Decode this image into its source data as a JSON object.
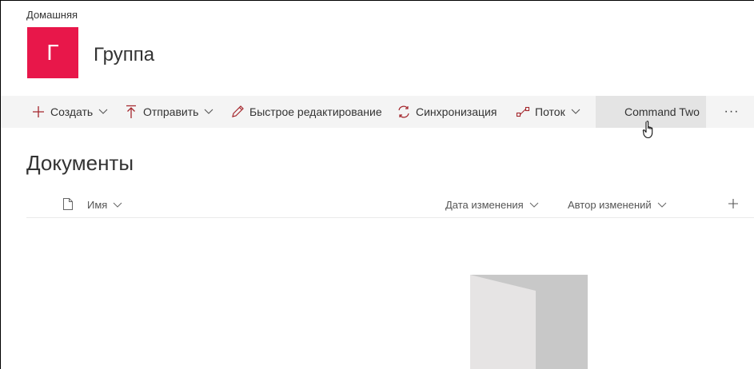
{
  "breadcrumb": "Домашняя",
  "site": {
    "logo_letter": "Г",
    "title": "Группа",
    "logo_color": "#e8174a"
  },
  "commandbar": {
    "items": [
      {
        "label": "Создать",
        "icon": "plus-icon",
        "has_dropdown": true
      },
      {
        "label": "Отправить",
        "icon": "upload-icon",
        "has_dropdown": true
      },
      {
        "label": "Быстрое редактирование",
        "icon": "pencil-icon",
        "has_dropdown": false
      },
      {
        "label": "Синхронизация",
        "icon": "sync-icon",
        "has_dropdown": false
      },
      {
        "label": "Поток",
        "icon": "flow-icon",
        "has_dropdown": true
      },
      {
        "label": "Command Two",
        "icon": "",
        "has_dropdown": false
      }
    ],
    "more_label": "···",
    "accent": "#a4262c"
  },
  "library": {
    "title": "Документы",
    "columns": [
      {
        "label": "Имя",
        "icon": "file-icon"
      },
      {
        "label": "Дата изменения"
      },
      {
        "label": "Автор изменений"
      }
    ]
  }
}
